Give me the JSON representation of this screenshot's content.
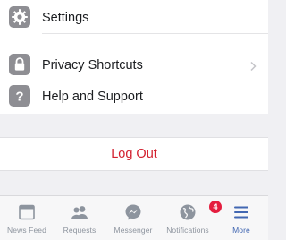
{
  "menu": {
    "items": [
      {
        "label": "Settings",
        "icon": "gear-icon"
      },
      {
        "label": "Privacy Shortcuts",
        "icon": "lock-icon"
      },
      {
        "label": "Help and Support",
        "icon": "question-icon"
      }
    ]
  },
  "logout": {
    "label": "Log Out"
  },
  "tabbar": {
    "tabs": [
      {
        "label": "News Feed",
        "icon": "news-feed-icon"
      },
      {
        "label": "Requests",
        "icon": "requests-icon"
      },
      {
        "label": "Messenger",
        "icon": "messenger-icon"
      },
      {
        "label": "Notifications",
        "icon": "globe-icon",
        "badge": "4"
      },
      {
        "label": "More",
        "icon": "hamburger-icon",
        "active": true
      }
    ]
  },
  "colors": {
    "accent": "#4267b2",
    "logout": "#d3202f",
    "badge": "#e41e3f",
    "inactive": "#8d949e"
  }
}
